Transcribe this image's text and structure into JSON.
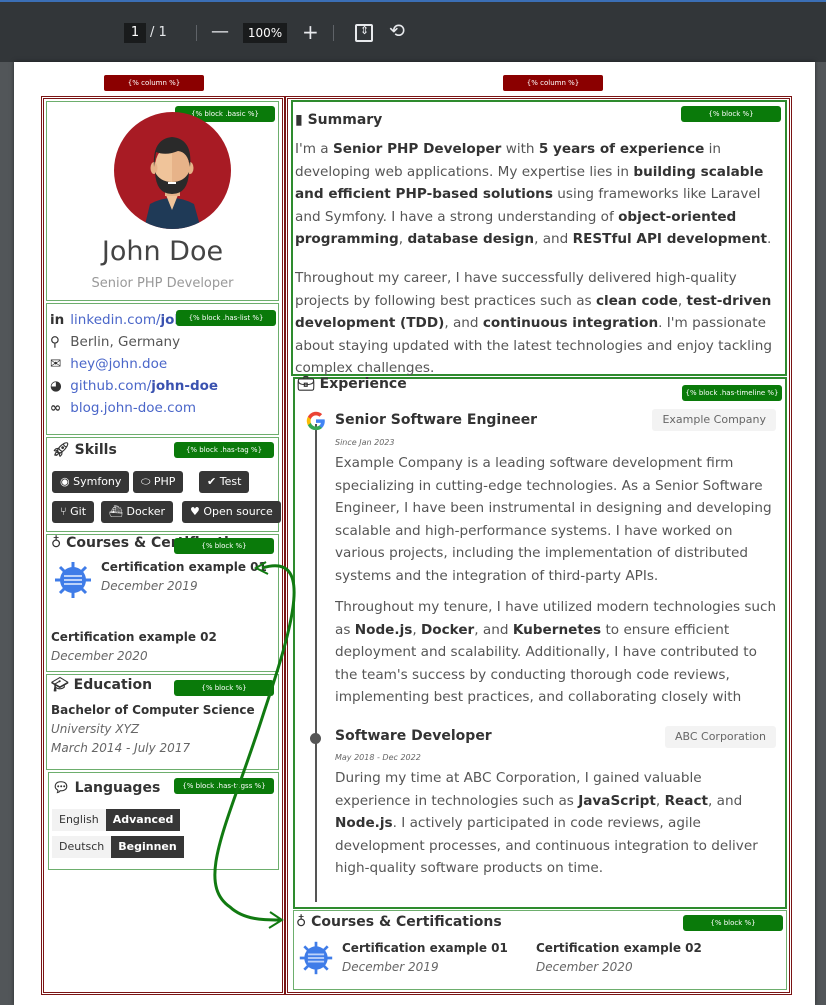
{
  "toolbar": {
    "current_page": "1",
    "total_pages": "/ 1",
    "zoom_out": "—",
    "zoom_level": "100%",
    "zoom_in": "+",
    "fit_icon": "fit-page-icon",
    "rotate_icon": "rotate-icon"
  },
  "labels": {
    "column": "{% column %}",
    "block_basic": "{% block .basic %}",
    "block_has_list": "{% block .has-list %}",
    "block_has_tag": "{% block .has-tag %}",
    "block": "{% block %}",
    "block_has_tagss": "{% block .has-tagss %}",
    "block_has_timeline": "{% block .has-timeline %}"
  },
  "profile": {
    "name": "John Doe",
    "title": "Senior PHP Developer"
  },
  "contacts": [
    {
      "icon": "linkedin-icon",
      "glyph": "in",
      "prefix": "linkedin.com/",
      "bold": "joh",
      "is_link": true
    },
    {
      "icon": "map-pin-icon",
      "glyph": "⚲",
      "prefix": "Berlin, Germany",
      "bold": "",
      "is_link": false
    },
    {
      "icon": "envelope-icon",
      "glyph": "✉",
      "prefix": "hey@john.doe",
      "bold": "",
      "is_link": true
    },
    {
      "icon": "github-icon",
      "glyph": "◕",
      "prefix": "github.com/",
      "bold": "john-doe",
      "is_link": true
    },
    {
      "icon": "link-icon",
      "glyph": "∞",
      "prefix": "blog.john-doe.com",
      "bold": "",
      "is_link": true
    }
  ],
  "skills": {
    "heading": "Skills",
    "tags": [
      {
        "icon": "symfony-icon",
        "glyph": "◉",
        "label": "Symfony"
      },
      {
        "icon": "php-icon",
        "glyph": "⬭",
        "label": "PHP"
      },
      {
        "icon": "check-double-icon",
        "glyph": "✔",
        "label": "Test"
      },
      {
        "icon": "git-branch-icon",
        "glyph": "⑂",
        "label": "Git"
      },
      {
        "icon": "docker-icon",
        "glyph": "⛴",
        "label": "Docker"
      },
      {
        "icon": "heart-icon",
        "glyph": "♥",
        "label": "Open source"
      }
    ]
  },
  "courses_left": {
    "heading": "Courses & Certifications",
    "items": [
      {
        "title": "Certification example 01",
        "date": "December 2019"
      },
      {
        "title": "Certification example 02",
        "date": "December 2020"
      }
    ]
  },
  "education": {
    "heading": "Education",
    "degree": "Bachelor of Computer Science",
    "school": "University XYZ",
    "dates": "March 2014 - July 2017"
  },
  "languages": {
    "heading": "Languages",
    "items": [
      {
        "language": "English",
        "level": "Advanced"
      },
      {
        "language": "Deutsch",
        "level": "Beginnen"
      }
    ]
  },
  "summary": {
    "heading": "Summary",
    "p1": [
      [
        "I'm a ",
        false
      ],
      [
        "Senior PHP Developer",
        true
      ],
      [
        " with ",
        false
      ],
      [
        "5 years of experience",
        true
      ],
      [
        " in developing web applications. My expertise lies in ",
        false
      ],
      [
        "building scalable and efficient PHP-based solutions",
        true
      ],
      [
        " using frameworks like Laravel and Symfony. I have a strong understanding of ",
        false
      ],
      [
        "object-oriented programming",
        true
      ],
      [
        ", ",
        false
      ],
      [
        "database design",
        true
      ],
      [
        ", and ",
        false
      ],
      [
        "RESTful API development",
        true
      ],
      [
        ".",
        false
      ]
    ],
    "p2": [
      [
        "Throughout my career, I have successfully delivered high-quality projects by following best practices such as ",
        false
      ],
      [
        "clean code",
        true
      ],
      [
        ", ",
        false
      ],
      [
        "test-driven development (TDD)",
        true
      ],
      [
        ", and ",
        false
      ],
      [
        "continuous integration",
        true
      ],
      [
        ". I'm passionate about staying updated with the latest technologies and enjoy tackling complex challenges.",
        false
      ]
    ]
  },
  "experience": {
    "heading": "Experience",
    "jobs": [
      {
        "title": "Senior Software Engineer",
        "company": "Example Company",
        "dates": "Since Jan 2023",
        "p1": [
          [
            "Example Company is a leading software development firm specializing in cutting-edge technologies. As a Senior Software Engineer, I have been instrumental in designing and developing scalable and high-performance systems. I have worked on various projects, including the implementation of distributed systems and the integration of third-party APIs.",
            false
          ]
        ],
        "p2": [
          [
            "Throughout my tenure, I have utilized modern technologies such as ",
            false
          ],
          [
            "Node.js",
            true
          ],
          [
            ", ",
            false
          ],
          [
            "Docker",
            true
          ],
          [
            ", and ",
            false
          ],
          [
            "Kubernetes",
            true
          ],
          [
            " to ensure efficient deployment and scalability. Additionally, I have contributed to the team's success by conducting thorough code reviews, implementing best practices, and collaborating closely with cross-functional teams.",
            false
          ]
        ]
      },
      {
        "title": "Software Developer",
        "company": "ABC Corporation",
        "dates": "May 2018 - Dec 2022",
        "p1": [
          [
            "During my time at ABC Corporation, I gained valuable experience in technologies such as ",
            false
          ],
          [
            "JavaScript",
            true
          ],
          [
            ", ",
            false
          ],
          [
            "React",
            true
          ],
          [
            ", and ",
            false
          ],
          [
            "Node.js",
            true
          ],
          [
            ". I actively participated in code reviews, agile development processes, and continuous integration to deliver high-quality software products on time.",
            false
          ]
        ]
      }
    ]
  },
  "courses_right": {
    "heading": "Courses & Certifications",
    "items": [
      {
        "title": "Certification example 01",
        "date": "December 2019"
      },
      {
        "title": "Certification example 02",
        "date": "December 2020"
      }
    ]
  },
  "colors": {
    "column_border": "#7a1414",
    "block_border": "#2e8b2e",
    "block_tag": "#0a7a0a",
    "avatar_bg": "#a81b24",
    "link": "#4a66c9",
    "tag_bg": "#363636"
  }
}
